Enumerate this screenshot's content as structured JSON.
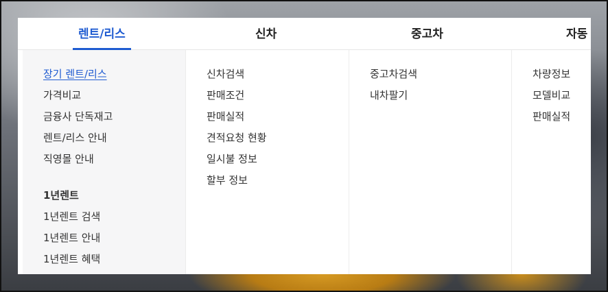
{
  "tabs": [
    {
      "label": "렌트/리스",
      "active": true
    },
    {
      "label": "신차",
      "active": false
    },
    {
      "label": "중고차",
      "active": false
    },
    {
      "label": "자동",
      "active": false
    }
  ],
  "rent": {
    "items": [
      "장기 렌트/리스",
      "가격비교",
      "금융사 단독재고",
      "렌트/리스 안내",
      "직영몰 안내"
    ],
    "selected_index": 0,
    "oneyear_title": "1년렌트",
    "oneyear_items": [
      "1년렌트 검색",
      "1년렌트 안내",
      "1년렌트 혜택"
    ]
  },
  "newcar": {
    "items": [
      "신차검색",
      "판매조건",
      "판매실적",
      "견적요청 현황",
      "일시불 정보",
      "할부 정보"
    ]
  },
  "usedcar": {
    "items": [
      "중고차검색",
      "내차팔기"
    ]
  },
  "auto": {
    "items": [
      "차량정보",
      "모델비교",
      "판매실적"
    ]
  },
  "colors": {
    "accent": "#1e5bd1",
    "text": "#333333"
  }
}
